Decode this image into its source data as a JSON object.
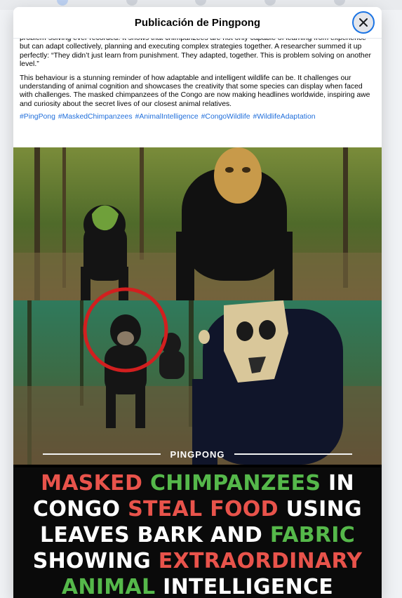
{
  "modal": {
    "title": "Publicación de Pingpong"
  },
  "post": {
    "paragraph1": "problem-solving ever recorded. It shows that chimpanzees are not only capable of learning from experience but can adapt collectively, planning and executing complex strategies together. A researcher summed it up perfectly: “They didn’t just learn from punishment. They adapted, together. This is problem solving on another level.”",
    "paragraph2": "This behaviour is a stunning reminder of how adaptable and intelligent wildlife can be. It challenges our understanding of animal cognition and showcases the creativity that some species can display when faced with challenges. The masked chimpanzees of the Congo are now making headlines worldwide, inspiring awe and curiosity about the secret lives of our closest animal relatives.",
    "hashtags": [
      "#PingPong",
      "#MaskedChimpanzees",
      "#AnimalIntelligence",
      "#CongoWildlife",
      "#WildlifeAdaptation"
    ]
  },
  "image": {
    "brand": "PINGPONG",
    "caption": {
      "w1": "MASKED",
      "w2": "CHIMPANZEES",
      "w3": "IN",
      "w4": "CONGO",
      "w5": "STEAL FOOD",
      "w6": "USING",
      "w7": "LEAVES BARK AND",
      "w8": "FABRIC",
      "w9": "SHOWING",
      "w10": "EXTRAORDINARY",
      "w11": "ANIMAL",
      "w12": "INTELLIGENCE"
    }
  },
  "colors": {
    "link": "#216fdb",
    "caption_red": "#e8534b",
    "caption_green": "#55b84a",
    "close_ring": "#1b74e4"
  },
  "icons": {
    "close": "close-icon"
  }
}
